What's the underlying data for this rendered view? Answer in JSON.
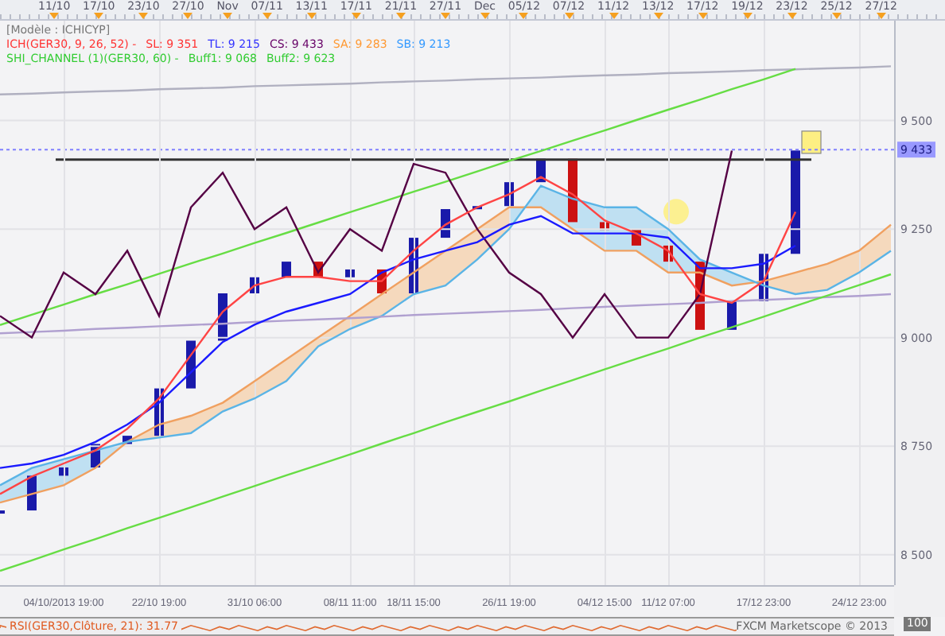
{
  "top_axis": {
    "labels": [
      "11/10",
      "17/10",
      "23/10",
      "27/10",
      "Nov",
      "07/11",
      "13/11",
      "17/11",
      "21/11",
      "27/11",
      "Dec",
      "05/12",
      "07/12",
      "11/12",
      "13/12",
      "17/12",
      "19/12",
      "23/12",
      "25/12",
      "27/12"
    ]
  },
  "legend": {
    "model": "[Modèle : ICHICYP]",
    "lines": [
      {
        "items": [
          {
            "text": "ICH(GER30, 9, 26, 52) -",
            "color": "#ff3333"
          },
          {
            "text": "SL: 9 351",
            "color": "#ff3333"
          },
          {
            "text": "TL: 9 215",
            "color": "#3333ff"
          },
          {
            "text": "CS: 9 433",
            "color": "#660066"
          },
          {
            "text": "SA: 9 283",
            "color": "#ff9933"
          },
          {
            "text": "SB: 9 213",
            "color": "#3399ff"
          }
        ]
      },
      {
        "items": [
          {
            "text": "SHI_CHANNEL (1)(GER30, 60) -",
            "color": "#33cc33"
          },
          {
            "text": "Buff1: 9 068",
            "color": "#33cc33"
          },
          {
            "text": "Buff2: 9 623",
            "color": "#33cc33"
          }
        ]
      }
    ]
  },
  "chart": {
    "chart_data": {
      "type": "line",
      "grid": true,
      "categories": [
        null,
        null,
        "04/10/2013 19:00",
        null,
        null,
        "22/10 19:00",
        null,
        null,
        "31/10 06:00",
        null,
        null,
        "08/11 11:00",
        null,
        "18/11 15:00",
        null,
        null,
        "26/11 19:00",
        null,
        null,
        "04/12 15:00",
        null,
        "11/12 07:00",
        null,
        null,
        "17/12 23:00",
        null,
        null,
        "24/12 23:00",
        null
      ],
      "ylim": [
        8430,
        9730
      ],
      "yticks": [
        {
          "value": 9500,
          "label": "9 500"
        },
        {
          "value": 9250,
          "label": "9 250"
        },
        {
          "value": 9000,
          "label": "9 000"
        },
        {
          "value": 8750,
          "label": "8 750"
        },
        {
          "value": 8500,
          "label": "8 500"
        }
      ],
      "series": [
        {
          "color": "#f0a060",
          "values": [
            8620,
            8640,
            8660,
            8700,
            8760,
            8800,
            8820,
            8850,
            8900,
            8950,
            9000,
            9050,
            9100,
            9150,
            9200,
            9250,
            9300,
            9300,
            9250,
            9200,
            9200,
            9150,
            9150,
            9120,
            9130,
            9150,
            9170,
            9200,
            9260
          ]
        },
        {
          "color": "#5ab4e6",
          "values": [
            8660,
            8700,
            8720,
            8740,
            8760,
            8770,
            8780,
            8830,
            8860,
            8900,
            8980,
            9020,
            9050,
            9100,
            9120,
            9180,
            9250,
            9350,
            9320,
            9300,
            9300,
            9250,
            9180,
            9150,
            9120,
            9100,
            9110,
            9150,
            9200
          ]
        },
        {
          "color": "#b0b0c0",
          "values": [
            9560,
            9562,
            9565,
            9567,
            9569,
            9572,
            9574,
            9576,
            9579,
            9581,
            9583,
            9585,
            9588,
            9590,
            9592,
            9595,
            9597,
            9599,
            9602,
            9604,
            9606,
            9609,
            9611,
            9613,
            9616,
            9618,
            9620,
            9622,
            9625
          ]
        },
        {
          "color": "#b0a0d0",
          "values": [
            9010,
            9013,
            9016,
            9020,
            9023,
            9026,
            9029,
            9032,
            9036,
            9039,
            9042,
            9045,
            9048,
            9052,
            9055,
            9058,
            9061,
            9064,
            9068,
            9071,
            9074,
            9077,
            9080,
            9084,
            9087,
            9090,
            9093,
            9096,
            9100
          ]
        },
        {
          "color": "#66dd44",
          "values": [
            8463,
            8487,
            8512,
            8536,
            8561,
            8585,
            8609,
            8634,
            8658,
            8683,
            8707,
            8731,
            8756,
            8780,
            8805,
            8829,
            8853,
            8878,
            8902,
            8927,
            8951,
            8975,
            9000,
            9024,
            9048,
            9073,
            9097,
            9121,
            9146
          ]
        },
        {
          "color": "#66dd44",
          "values": [
            9029,
            9053,
            9076,
            9100,
            9123,
            9147,
            9171,
            9194,
            9218,
            9241,
            9265,
            9289,
            9312,
            9336,
            9359,
            9383,
            9407,
            9430,
            9454,
            9477,
            9501,
            9525,
            9548,
            9572,
            9595,
            9619,
            null,
            null,
            null
          ]
        },
        {
          "color": "#550044",
          "values": [
            9050,
            9000,
            9150,
            9100,
            9200,
            9050,
            9300,
            9380,
            9250,
            9300,
            9150,
            9250,
            9200,
            9400,
            9380,
            9250,
            9150,
            9100,
            9000,
            9100,
            9000,
            9000,
            9100,
            9431,
            null,
            null,
            null,
            null,
            null
          ]
        },
        {
          "color": "#1a1aff",
          "values": [
            8700,
            8710,
            8730,
            8760,
            8800,
            8850,
            8920,
            8990,
            9030,
            9060,
            9080,
            9100,
            9150,
            9180,
            9200,
            9220,
            9260,
            9280,
            9240,
            9240,
            9240,
            9230,
            9160,
            9160,
            9170,
            9212,
            null,
            null,
            null
          ]
        },
        {
          "color": "#ff4444",
          "values": [
            8640,
            8680,
            8710,
            8740,
            8790,
            8860,
            8960,
            9060,
            9120,
            9140,
            9140,
            9130,
            9130,
            9200,
            9260,
            9300,
            9330,
            9370,
            9330,
            9270,
            9240,
            9200,
            9100,
            9080,
            9130,
            9290,
            null,
            null,
            null
          ]
        }
      ]
    },
    "price_tag": {
      "label": "9 433"
    }
  },
  "indicator": {
    "label": "RSI(GER30,Clôture, 21): 31.77",
    "scale_label": "100",
    "credit": "FXCM Marketscope © 2013"
  }
}
